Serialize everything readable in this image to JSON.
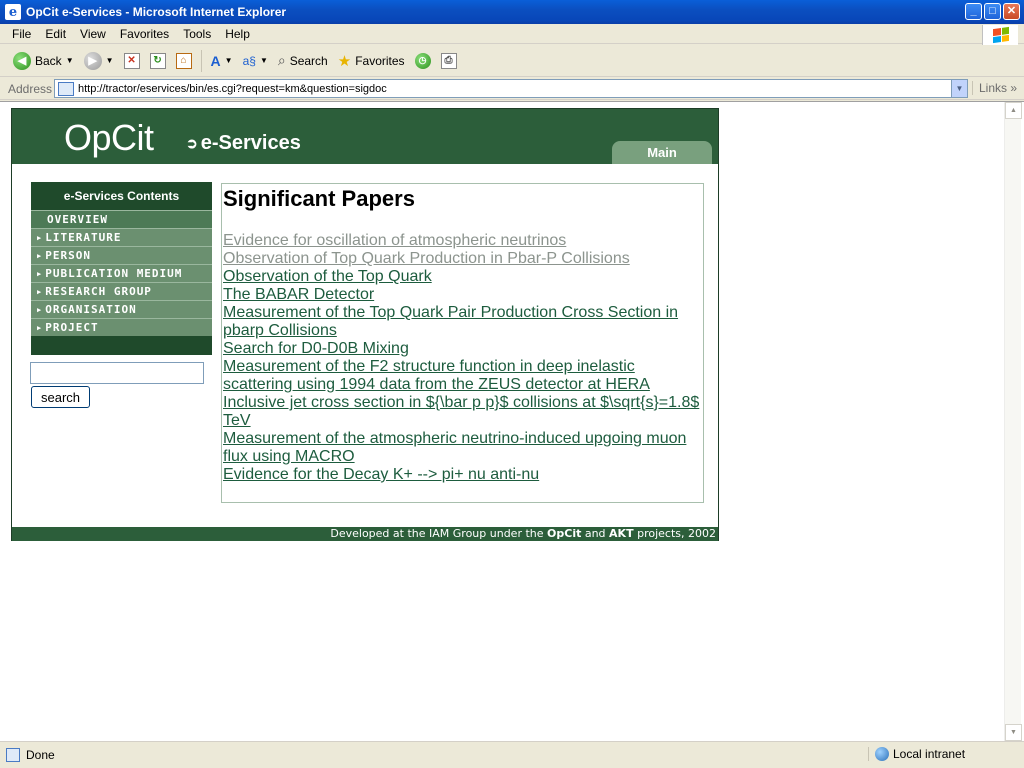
{
  "window": {
    "title": "OpCit e-Services - Microsoft Internet Explorer",
    "icon": "ie-icon",
    "buttons": [
      "minimize",
      "maximize",
      "close"
    ]
  },
  "menu": [
    "File",
    "Edit",
    "View",
    "Favorites",
    "Tools",
    "Help"
  ],
  "toolbar": {
    "back_label": "Back",
    "search_label": "Search",
    "favorites_label": "Favorites"
  },
  "address": {
    "label": "Address",
    "url": "http://tractor/eservices/bin/es.cgi?request=km&question=sigdoc",
    "links_label": "Links"
  },
  "site": {
    "logo": "OpCit",
    "subtitle": "e-Services",
    "main_tab": "Main",
    "footer_prefix": "Developed at the IAM Group under the ",
    "footer_opcit": "OpCit",
    "footer_and": " and ",
    "footer_akt": "AKT",
    "footer_suffix": " projects, 2002"
  },
  "sidebar": {
    "heading": "e-Services Contents",
    "items": [
      "OVERVIEW",
      "LITERATURE",
      "PERSON",
      "PUBLICATION MEDIUM",
      "RESEARCH GROUP",
      "ORGANISATION",
      "PROJECT"
    ],
    "search_value": "",
    "search_button": "search"
  },
  "papers": {
    "heading": "Significant Papers",
    "items": [
      {
        "title": "Evidence for oscillation of atmospheric neutrinos",
        "visited": true
      },
      {
        "title": "Observation of Top Quark Production in Pbar-P Collisions",
        "visited": true
      },
      {
        "title": "Observation of the Top Quark",
        "visited": false
      },
      {
        "title": "The BABAR Detector",
        "visited": false
      },
      {
        "title": "Measurement of the Top Quark Pair Production Cross Section in pbarp Collisions",
        "visited": false
      },
      {
        "title": "Search for D0-D0B Mixing",
        "visited": false
      },
      {
        "title": "Measurement of the F2 structure function in deep inelastic scattering using 1994 data from the ZEUS detector at HERA",
        "visited": false
      },
      {
        "title": "Inclusive jet cross section in ${\\bar p p}$ collisions at $\\sqrt{s}=1.8$ TeV",
        "visited": false
      },
      {
        "title": "Measurement of the atmospheric neutrino-induced upgoing muon flux using MACRO",
        "visited": false
      },
      {
        "title": "Evidence for the Decay K+ --> pi+ nu anti-nu",
        "visited": false
      }
    ]
  },
  "status": {
    "text": "Done",
    "zone": "Local intranet"
  }
}
